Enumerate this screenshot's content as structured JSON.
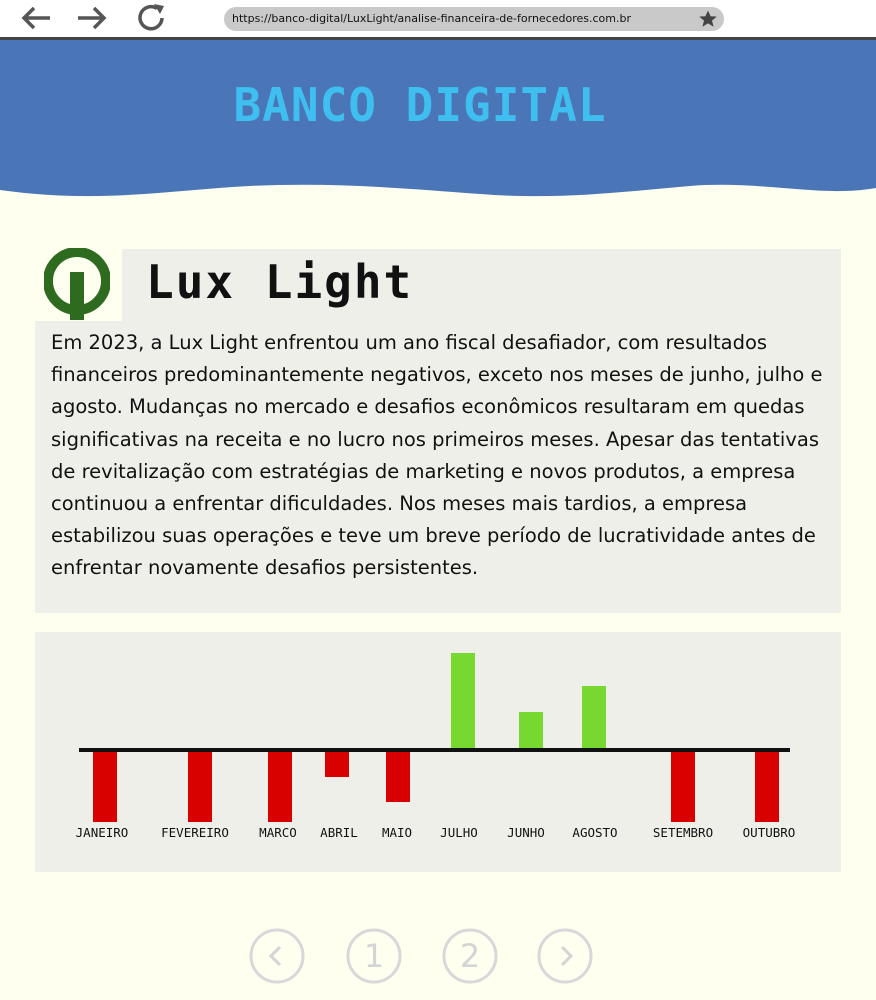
{
  "browser": {
    "url": "https://banco-digital/LuxLight/analise-financeira-de-fornecedores.com.br",
    "back_icon": "arrow-left-icon",
    "forward_icon": "arrow-right-icon",
    "reload_icon": "reload-icon",
    "bookmark_icon": "star-icon"
  },
  "header": {
    "brand": "BANCO DIGITAL",
    "bg_color": "#4a76b8",
    "brand_color": "#3fbff0"
  },
  "company": {
    "name": "Lux Light",
    "logo_icon": "lux-light-logo",
    "logo_color": "#2e6b1f",
    "description": "Em 2023, a Lux Light enfrentou um ano fiscal desafiador, com resultados financeiros predominantemente negativos, exceto nos meses de junho, julho e agosto. Mudanças no mercado e desafios econômicos resultaram em quedas significativas na receita e no lucro nos primeiros meses. Apesar das tentativas de revitalização com estratégias de marketing e novos produtos, a empresa continuou a enfrentar dificuldades. Nos meses mais tardios, a empresa estabilizou suas operações e teve um breve período de lucratividade antes de enfrentar novamente desafios persistentes."
  },
  "chart_data": {
    "type": "bar",
    "categories": [
      "JANEIRO",
      "FEVEREIRO",
      "MARCO",
      "ABRIL",
      "MAIO",
      "JULHO",
      "JUNHO",
      "AGOSTO",
      "SETEMBRO",
      "OUTUBRO"
    ],
    "values": [
      -72,
      -72,
      -72,
      -27,
      -52,
      97,
      38,
      64,
      -72,
      -72
    ],
    "positive_color": "#77d930",
    "negative_color": "#d90000",
    "grid": false,
    "title": "",
    "xlabel": "",
    "ylabel": ""
  },
  "pagination": {
    "prev_icon": "chevron-left-icon",
    "pages": [
      "1",
      "2"
    ],
    "next_icon": "chevron-right-icon"
  }
}
